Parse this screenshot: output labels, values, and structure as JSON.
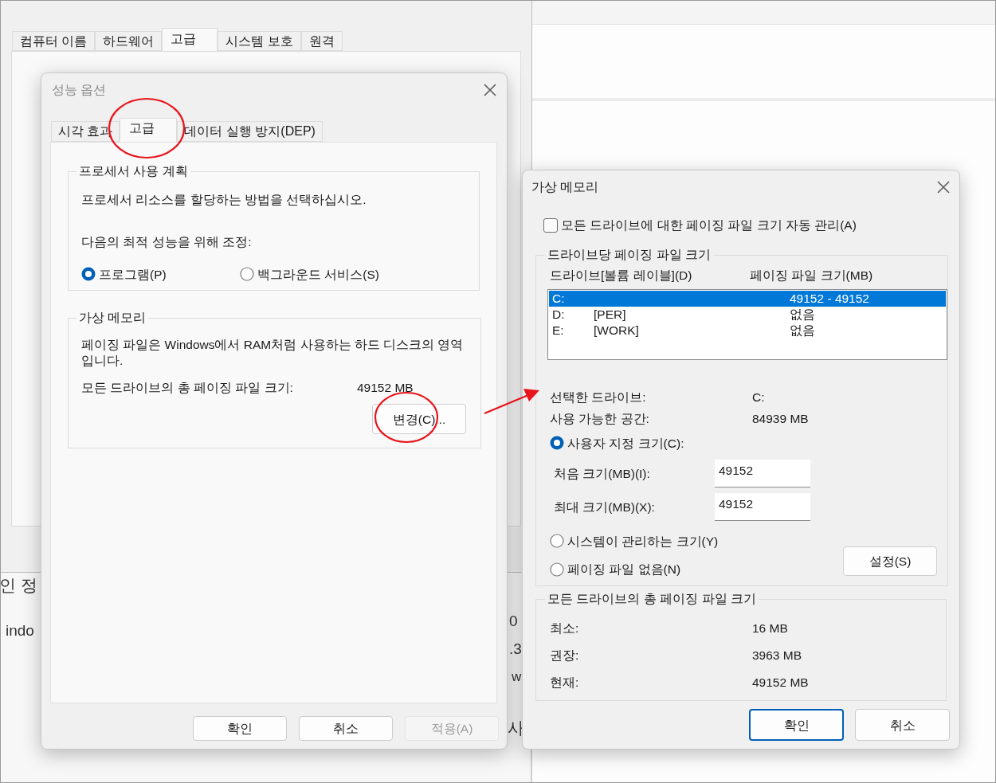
{
  "background_window": {
    "tabs": [
      {
        "label": "컴퓨터 이름",
        "selected": false
      },
      {
        "label": "하드웨어",
        "selected": false
      },
      {
        "label": "고급",
        "selected": true
      },
      {
        "label": "시스템 보호",
        "selected": false
      },
      {
        "label": "원격",
        "selected": false
      }
    ]
  },
  "background_page": {
    "fragments": [
      "인 정",
      "indo",
      "0",
      ".3",
      "w",
      "사"
    ]
  },
  "performance_options": {
    "title": "성능 옵션",
    "active": false,
    "tabs": [
      {
        "label": "시각 효과",
        "selected": false
      },
      {
        "label": "고급",
        "selected": true
      },
      {
        "label": "데이터 실행 방지(DEP)",
        "selected": false
      }
    ],
    "processor_group": {
      "title": "프로세서 사용 계획",
      "description": "프로세서 리소스를 할당하는 방법을 선택하십시오.",
      "prompt": "다음의 최적 성능을 위해 조정:",
      "options": [
        {
          "label": "프로그램(P)",
          "selected": true
        },
        {
          "label": "백그라운드 서비스(S)",
          "selected": false
        }
      ]
    },
    "memory_group": {
      "title": "가상 메모리",
      "description": "페이징 파일은 Windows에서 RAM처럼 사용하는 하드 디스크의 영역입니다.",
      "total_label": "모든 드라이브의 총 페이징 파일 크기:",
      "total_value": "49152 MB",
      "change_button": "변경(C)..."
    },
    "buttons": [
      {
        "label": "확인",
        "disabled": false
      },
      {
        "label": "취소",
        "disabled": false
      },
      {
        "label": "적용(A)",
        "disabled": true
      }
    ]
  },
  "virtual_memory": {
    "title": "가상 메모리",
    "active": true,
    "auto_manage": {
      "label": "모든 드라이브에 대한 페이징 파일 크기 자동 관리(A)",
      "checked": false
    },
    "per_drive": {
      "title": "드라이브당 페이징 파일 크기",
      "columns": [
        "드라이브[볼륨 레이블](D)",
        "페이징 파일 크기(MB)"
      ],
      "rows": [
        {
          "drive": "C:",
          "size": "49152 - 49152",
          "selected": true
        },
        {
          "drive": "D:",
          "label": "[PER]",
          "size": "없음",
          "selected": false
        },
        {
          "drive": "E:",
          "label": "[WORK]",
          "size": "없음",
          "selected": false
        }
      ],
      "info": [
        {
          "label": "선택한 드라이브:",
          "value": "C:"
        },
        {
          "label": "사용 가능한 공간:",
          "value": "84939 MB"
        }
      ],
      "custom_size": {
        "label": "사용자 지정 크기(C):",
        "selected": true
      },
      "fields": [
        {
          "label": "처음 크기(MB)(I):",
          "value": "49152"
        },
        {
          "label": "최대 크기(MB)(X):",
          "value": "49152"
        }
      ],
      "other_options": [
        {
          "label": "시스템이 관리하는 크기(Y)",
          "selected": false
        },
        {
          "label": "페이징 파일 없음(N)",
          "selected": false
        }
      ],
      "set_button": "설정(S)"
    },
    "totals": {
      "title": "모든 드라이브의 총 페이징 파일 크기",
      "rows": [
        {
          "label": "최소:",
          "value": "16 MB"
        },
        {
          "label": "권장:",
          "value": "3963 MB"
        },
        {
          "label": "현재:",
          "value": "49152 MB"
        }
      ]
    },
    "buttons": [
      {
        "label": "확인",
        "default": true
      },
      {
        "label": "취소",
        "default": false
      }
    ]
  }
}
